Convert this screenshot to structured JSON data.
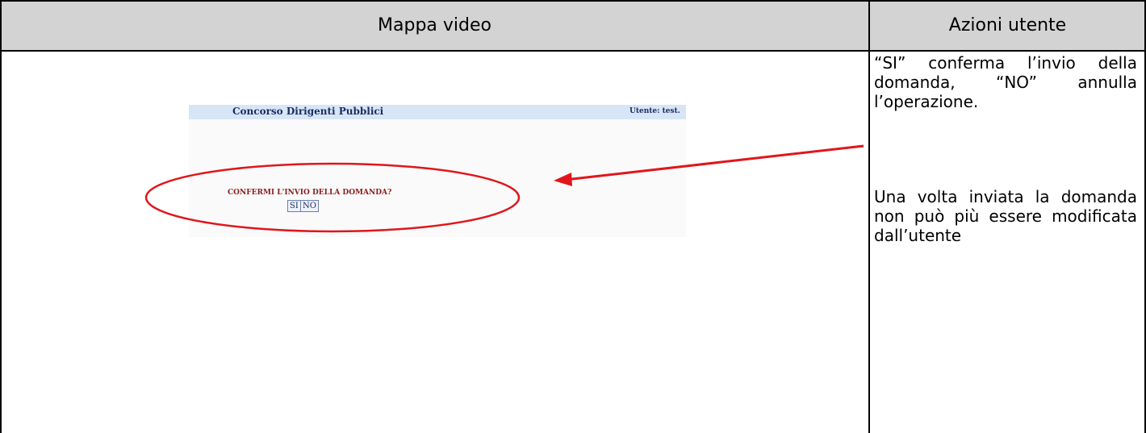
{
  "table": {
    "header_left": "Mappa video",
    "header_right": "Azioni utente"
  },
  "screenshot": {
    "app_title": "Concorso Dirigenti Pubblici",
    "user_label": "Utente: test.",
    "question": "CONFERMI L'INVIO DELLA DOMANDA?",
    "yes_button": "SI",
    "no_button": "NO"
  },
  "notes": {
    "confirm": "“SI” conferma l’invio della domanda, “NO” annulla l’operazione.",
    "warning": "Una volta inviata la domanda non può più essere modificata dall’utente"
  },
  "annotation": {
    "color": "#e0161b",
    "ellipse_icon": "highlight-ellipse",
    "arrow_icon": "pointer-arrow"
  }
}
